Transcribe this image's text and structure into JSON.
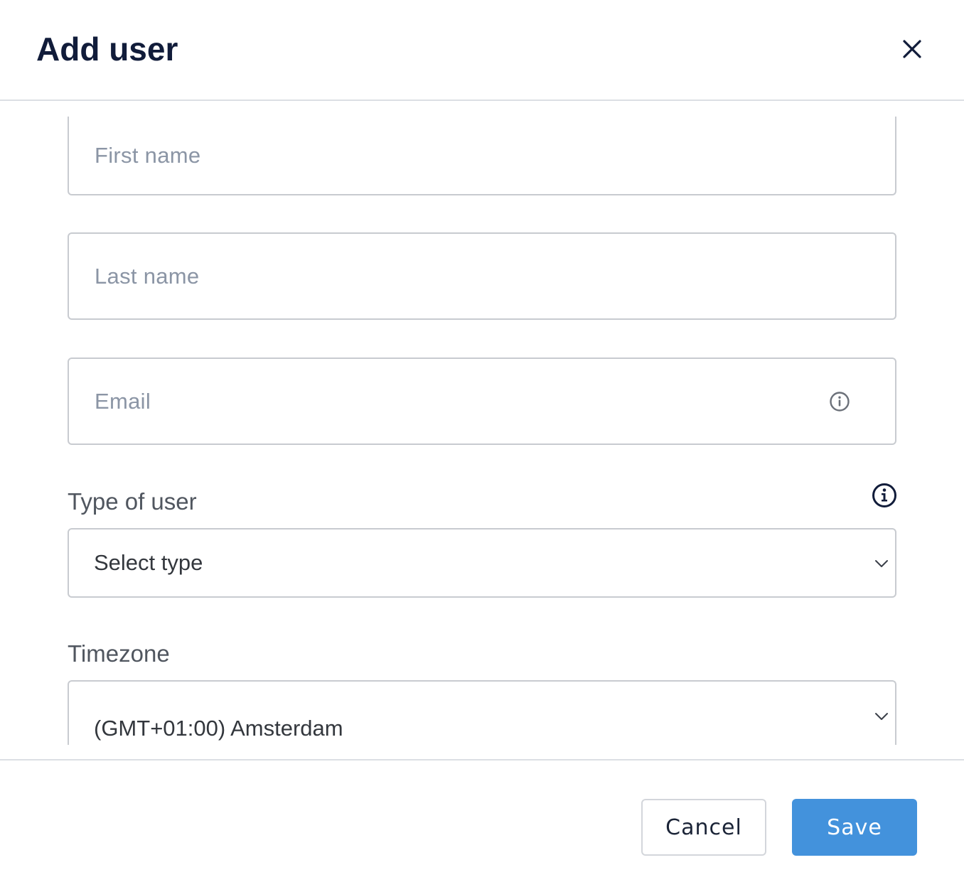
{
  "dialog": {
    "title": "Add user",
    "close_icon": "close-icon"
  },
  "form": {
    "first_name": {
      "placeholder": "First name"
    },
    "last_name": {
      "placeholder": "Last name"
    },
    "email": {
      "placeholder": "Email",
      "icon": "info-outline-icon"
    },
    "type_of_user": {
      "label": "Type of user",
      "label_icon": "info-circle-icon",
      "selected": "Select type",
      "icon": "chevron-down-icon"
    },
    "timezone": {
      "label": "Timezone",
      "selected": "(GMT+01:00) Amsterdam",
      "icon": "chevron-down-icon"
    }
  },
  "footer": {
    "cancel_label": "Cancel",
    "save_label": "Save"
  },
  "colors": {
    "primary": "#4392dc",
    "title": "#111c3a",
    "border": "#c8cbd0",
    "placeholder": "#8b95a5"
  }
}
